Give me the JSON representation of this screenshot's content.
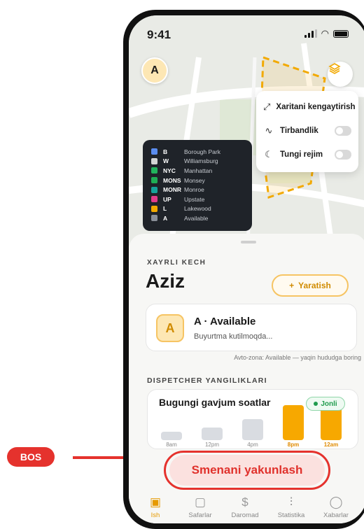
{
  "annotation": {
    "label": "BOS",
    "color": "#e5322d"
  },
  "status_bar": {
    "time": "9:41"
  },
  "map": {
    "avatar_initial": "A",
    "layers_icon": "layers-icon",
    "layer_menu": [
      {
        "icon": "expand-icon",
        "label": "Xaritani kengaytirish",
        "has_toggle": false
      },
      {
        "icon": "traffic-icon",
        "label": "Tirbandlik",
        "has_toggle": true,
        "on": false
      },
      {
        "icon": "moon-icon",
        "label": "Tungi rejim",
        "has_toggle": true,
        "on": false
      }
    ],
    "legend": [
      {
        "code": "B",
        "name": "Borough Park",
        "color": "#5b8def"
      },
      {
        "code": "W",
        "name": "Williamsburg",
        "color": "#d4d4d4"
      },
      {
        "code": "NYC",
        "name": "Manhattan",
        "color": "#22b35c"
      },
      {
        "code": "MONS",
        "name": "Monsey",
        "color": "#1fae55"
      },
      {
        "code": "MONR",
        "name": "Monroe",
        "color": "#16a39a"
      },
      {
        "code": "UP",
        "name": "Upstate",
        "color": "#e23c8a"
      },
      {
        "code": "L",
        "name": "Lakewood",
        "color": "#f2a900"
      },
      {
        "code": "A",
        "name": "Available",
        "color": "#8a8f98"
      }
    ]
  },
  "sheet": {
    "greeting": "XAYRLI KECH",
    "driver_name": "Aziz",
    "create_button": {
      "icon": "+",
      "label": "Yaratish"
    },
    "zone_card": {
      "badge": "A",
      "title": "A · Available",
      "subtitle": "Buyurtma kutilmoqda..."
    },
    "auto_zone_note": "Avto-zona: Available — yaqin hududga boring",
    "news_heading": "DISPETCHER YANGILIKLARI",
    "news_card": {
      "title": "Bugungi gavjum soatlar",
      "live_label": "Jonli"
    },
    "end_shift_button": "Smenani yakunlash"
  },
  "chart_data": {
    "type": "bar",
    "title": "Bugungi gavjum soatlar",
    "categories": [
      "8am",
      "12pm",
      "4pm",
      "8pm",
      "12am"
    ],
    "values": [
      1,
      1.5,
      2.5,
      4.2,
      4
    ],
    "highlighted": [
      "8pm",
      "12am"
    ],
    "colors": {
      "normal": "#d9dce1",
      "peak": "#f7a800"
    }
  },
  "tab_bar": [
    {
      "icon": "briefcase-icon",
      "glyph": "▣",
      "label": "Ish",
      "active": true
    },
    {
      "icon": "clipboard-icon",
      "glyph": "▢",
      "label": "Safarlar",
      "active": false
    },
    {
      "icon": "dollar-icon",
      "glyph": "$",
      "label": "Daromad",
      "active": false
    },
    {
      "icon": "stats-icon",
      "glyph": "⫶",
      "label": "Statistika",
      "active": false
    },
    {
      "icon": "chat-icon",
      "glyph": "◯",
      "label": "Xabarlar",
      "active": false
    }
  ]
}
